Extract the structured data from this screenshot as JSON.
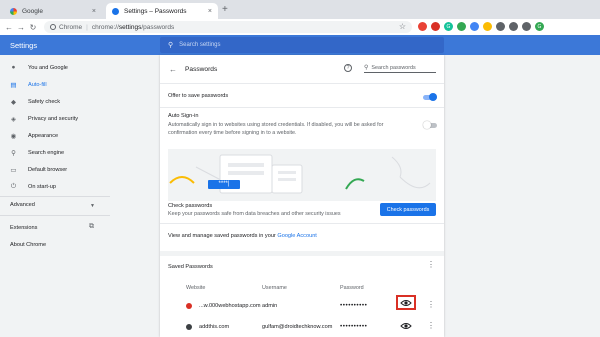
{
  "browser": {
    "tabs": [
      {
        "label": "Google",
        "favicon": "google-icon",
        "active": false
      },
      {
        "label": "Settings – Passwords",
        "favicon": "settings-gear-icon",
        "active": true
      }
    ],
    "new_tab": "+",
    "close_glyph": "×",
    "omnibox": {
      "scheme_label": "Chrome",
      "separator": "|",
      "url_prefix": "chrome://",
      "url_host": "settings",
      "url_path": "/passwords"
    },
    "extensions": [
      {
        "name": "vivaldi-ext-icon",
        "color": "#e94235",
        "glyph": ""
      },
      {
        "name": "shield-ext-icon",
        "color": "#d93025",
        "glyph": ""
      },
      {
        "name": "grammarly-ext-icon",
        "color": "#15c39a",
        "glyph": "G"
      },
      {
        "name": "green-ext-icon",
        "color": "#34a853",
        "glyph": ""
      },
      {
        "name": "bookmark-ext-icon",
        "color": "#4285f4",
        "glyph": ""
      },
      {
        "name": "keep-ext-icon",
        "color": "#fbbc04",
        "glyph": ""
      },
      {
        "name": "stack-ext-icon",
        "color": "#5f6368",
        "glyph": ""
      },
      {
        "name": "puzzle-extensions-icon",
        "color": "#5f6368",
        "glyph": ""
      },
      {
        "name": "reading-list-icon",
        "color": "#5f6368",
        "glyph": ""
      },
      {
        "name": "profile-avatar",
        "color": "#34a853",
        "glyph": "G"
      }
    ]
  },
  "settings": {
    "title": "Settings",
    "search_placeholder": "Search settings"
  },
  "sidebar": {
    "items": [
      {
        "label": "You and Google",
        "icon": "person-icon"
      },
      {
        "label": "Auto-fill",
        "icon": "autofill-icon",
        "active": true
      },
      {
        "label": "Safety check",
        "icon": "safety-shield-icon"
      },
      {
        "label": "Privacy and security",
        "icon": "privacy-shield-icon"
      },
      {
        "label": "Appearance",
        "icon": "palette-icon"
      },
      {
        "label": "Search engine",
        "icon": "search-icon"
      },
      {
        "label": "Default browser",
        "icon": "browser-icon"
      },
      {
        "label": "On start-up",
        "icon": "power-icon"
      }
    ],
    "advanced": "Advanced",
    "extensions": "Extensions",
    "about": "About Chrome"
  },
  "passwords": {
    "title": "Passwords",
    "search_placeholder": "Search passwords",
    "offer_to_save": {
      "label": "Offer to save passwords",
      "enabled": true
    },
    "auto_signin": {
      "label": "Auto Sign-in",
      "description": "Automatically sign in to websites using stored credentials. If disabled, you will be asked for confirmation every time before signing in to a website.",
      "enabled": false
    },
    "illustration_stars": "****|",
    "check": {
      "title": "Check passwords",
      "description": "Keep your passwords safe from data breaches and other security issues",
      "button": "Check passwords"
    },
    "manage": {
      "text": "View and manage saved passwords in your ",
      "link": "Google Account"
    },
    "saved_title": "Saved Passwords",
    "columns": {
      "website": "Website",
      "username": "Username",
      "password": "Password"
    },
    "rows": [
      {
        "site": "...w.000webhostapp.com",
        "username": "admin",
        "password": "••••••••••",
        "favicon_color": "#d93025"
      },
      {
        "site": "addthis.com",
        "username": "gulfam@droidtechknow.com",
        "password": "••••••••••",
        "favicon_color": "#3c4043"
      }
    ],
    "colors": {
      "accent": "#1a73e8",
      "header": "#3c78d8",
      "highlight": "#d93025"
    }
  }
}
